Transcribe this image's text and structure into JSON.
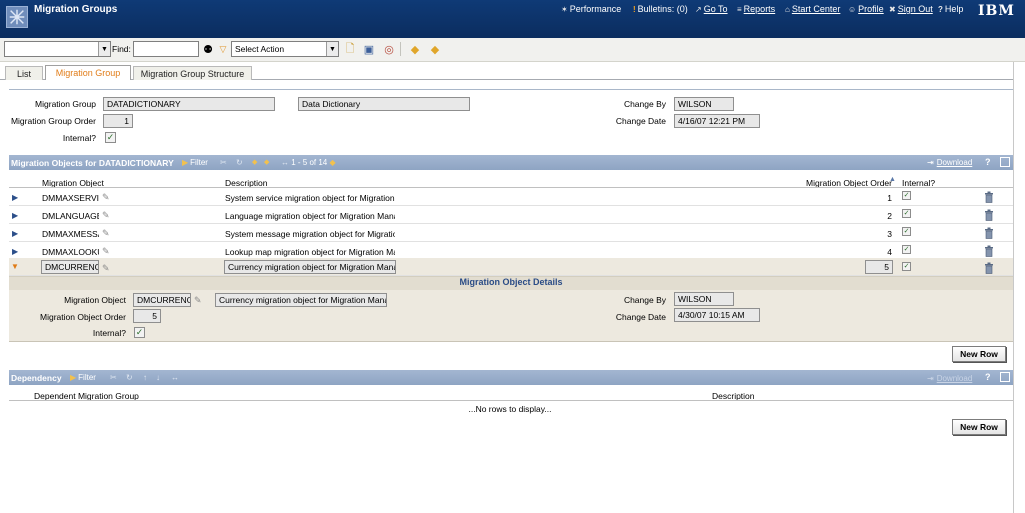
{
  "app": {
    "title": "Migration Groups",
    "brand": "IBM"
  },
  "nav": [
    {
      "label": "Performance",
      "icon": "performance-icon",
      "glyph": "✶"
    },
    {
      "label": "Bulletins: (0)",
      "icon": "bulletins-icon",
      "glyph": "!"
    },
    {
      "label": "Go To",
      "icon": "goto-icon",
      "glyph": "↗"
    },
    {
      "label": "Reports",
      "icon": "reports-icon",
      "glyph": "≡"
    },
    {
      "label": "Start Center",
      "icon": "start-center-icon",
      "glyph": "⌂"
    },
    {
      "label": "Profile",
      "icon": "profile-icon",
      "glyph": "☺"
    },
    {
      "label": "Sign Out",
      "icon": "sign-out-icon",
      "glyph": "✖"
    },
    {
      "label": "Help",
      "icon": "help-icon",
      "glyph": "?"
    }
  ],
  "toolbar": {
    "search_value": "",
    "find_label": "Find:",
    "find_value": "",
    "select_action": "Select Action"
  },
  "tabs": [
    {
      "label": "List"
    },
    {
      "label": "Migration Group"
    },
    {
      "label": "Migration Group Structure"
    }
  ],
  "header": {
    "group_label": "Migration Group",
    "group_value": "DATADICTIONARY",
    "group_desc": "Data Dictionary",
    "order_label": "Migration Group Order",
    "order_value": "1",
    "internal_label": "Internal?",
    "changeby_label": "Change By",
    "changeby_value": "WILSON",
    "changedate_label": "Change Date",
    "changedate_value": "4/16/07 12:21 PM"
  },
  "objects": {
    "title": "Migration Objects for DATADICTIONARY",
    "filter": "Filter",
    "paging": "1 - 5 of 14",
    "download": "Download",
    "col_object": "Migration Object",
    "col_description": "Description",
    "col_order": "Migration Object Order",
    "col_internal": "Internal?",
    "rows": [
      {
        "object": "DMMAXSERVIC",
        "description": "System service migration object for Migration M",
        "order": "1"
      },
      {
        "object": "DMLANGUAGE",
        "description": "Language migration object for Migration Manage",
        "order": "2"
      },
      {
        "object": "DMMAXMESSAG",
        "description": "System message migration object for Migration",
        "order": "3"
      },
      {
        "object": "DMMAXLOOKUI",
        "description": "Lookup map migration object for Migration Mana",
        "order": "4"
      },
      {
        "object": "DMCURRENCY",
        "description": "Currency migration object for Migration Manage",
        "order": "5"
      }
    ],
    "new_row": "New Row"
  },
  "details": {
    "title": "Migration Object Details",
    "object_label": "Migration Object",
    "object_value": "DMCURRENCY",
    "object_desc": "Currency migration object for Migration Manage",
    "order_label": "Migration Object Order",
    "order_value": "5",
    "internal_label": "Internal?",
    "changeby_label": "Change By",
    "changeby_value": "WILSON",
    "changedate_label": "Change Date",
    "changedate_value": "4/30/07 10:15 AM"
  },
  "dependency": {
    "title": "Dependency",
    "filter": "Filter",
    "download": "Download",
    "col_group": "Dependent Migration Group",
    "col_description": "Description",
    "empty": "...No rows to display...",
    "new_row": "New Row"
  },
  "colors": {
    "title_bar": "#0f3a76",
    "section_bar": "#98acc9",
    "active_tab": "#e17d1a"
  }
}
